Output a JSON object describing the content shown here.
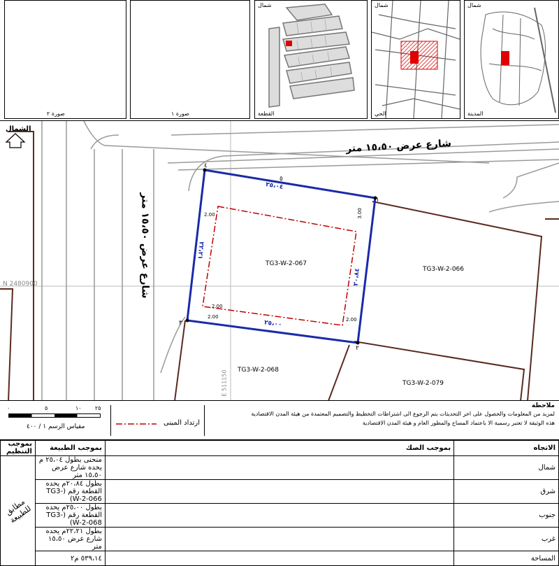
{
  "thumbnails": {
    "pic2_caption": "صورة ٢",
    "pic1_caption": "صورة ١",
    "plot_caption": "القطعة",
    "district_caption": "الحي",
    "city_caption": "المدينة",
    "north_label": "شمال"
  },
  "map": {
    "north_label": "الشمال",
    "street_north": "شارع عرض ١٥،٥٠ متر",
    "street_west": "شارع عرض ١٥،٥٠ متر",
    "parcel_main": "TG3-W-2-067",
    "parcel_east": "TG3-W-2-066",
    "parcel_south": "TG3-W-2-068",
    "parcel_southeast": "TG3-W-2-079",
    "grid_label": "N 2480900",
    "grid_label_v": "E 511150",
    "dim_north": "٢٥،٠٤",
    "dim_south": "٢٥،٠٠",
    "dim_east": "٢٠،٨٤",
    "dim_west": "٢٢،٢١",
    "setback_values": [
      "2.00",
      "3.00",
      "2.00",
      "2.00",
      "2.00"
    ],
    "corner_numbers": [
      "١",
      "٢",
      "٣",
      "٤",
      "٥"
    ]
  },
  "notes": {
    "title": "ملاحظة",
    "note1": "لمزيد من المعلومات والحصول على اخر التحديثات يتم الرجوع الى اشتراطات التخطيط والتصميم المعتمدة من هيئة المدن الاقتصادية",
    "note2": "هذه الوثيقة لا تعتبر رسمية الا باعتماد المساح والمطور العام و هيئة المدن الاقتصادية",
    "legend_label": "ارتداد المبنى",
    "scale_label": "مقياس الرسم ١ / ٤٠٠",
    "scale_ticks": [
      "٠",
      "٥",
      "١٠",
      "٢٥"
    ]
  },
  "table": {
    "headers": [
      "الاتجاه",
      "بموجب الصك",
      "بموجب الطبيعة",
      "بموجب التنظيم"
    ],
    "rows": [
      {
        "dir": "شمال",
        "nature": "منحنى بطول ٢٥،٠٤ م يحده شارع عرض ١٥،٥٠ متر"
      },
      {
        "dir": "شرق",
        "nature": "بطول ٢٠،٨٤م يحده القطعة رقم (TG3-W-2-066)"
      },
      {
        "dir": "جنوب",
        "nature": "بطول ٢٥،٠٠م يحده القطعة رقم (TG3-W-2-068)"
      },
      {
        "dir": "غرب",
        "nature": "بطول ٢٢،٢١م يحده شارع عرض ١٥،٥٠ متر"
      },
      {
        "dir": "المساحة",
        "nature": "٥٣٩،١٤ م٢"
      }
    ],
    "stamp": "مطابق للطبيعة"
  }
}
